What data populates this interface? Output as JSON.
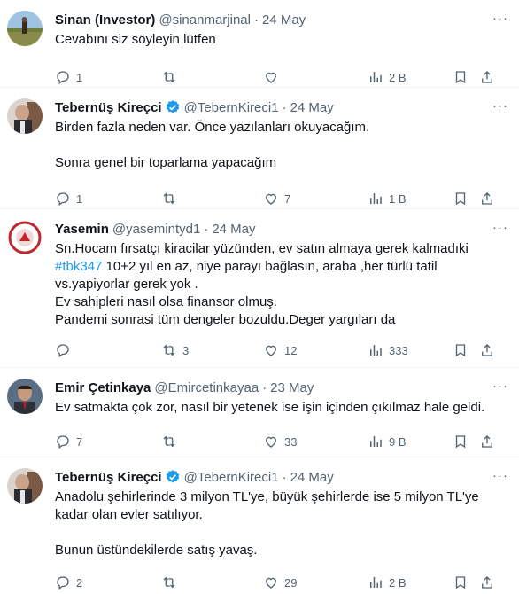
{
  "tweets": [
    {
      "name": "Sinan (Investor)",
      "verified": false,
      "handle": "@sinanmarjinal",
      "dot": "·",
      "date": "24 May",
      "text": "Cevabını siz söyleyin lütfen",
      "replies": "1",
      "retweets": "",
      "likes": "",
      "views": "2 B"
    },
    {
      "name": "Tebernüş Kireçci",
      "verified": true,
      "handle": "@TebernKireci1",
      "dot": "·",
      "date": "24 May",
      "text": "Birden fazla neden var. Önce yazılanları okuyacağım.\n\nSonra genel bir toparlama yapacağım",
      "replies": "1",
      "retweets": "",
      "likes": "7",
      "views": "1 B"
    },
    {
      "name": "Yasemin",
      "verified": false,
      "handle": "@yasemintyd1",
      "dot": "·",
      "date": "24 May",
      "text_before": "Sn.Hocam fırsatçı kiracilar yüzünden, ev satın almaya gerek kalmadıki\n",
      "hashtag": "#tbk347",
      "text_after": " 10+2 yıl en az, niye parayı bağlasın, araba ,her türlü tatil\nvs.yapiyorlar gerek  yok .\nEv sahipleri nasıl olsa finansor olmuş.\nPandemi sonrasi tüm dengeler bozuldu.Deger yargıları da",
      "replies": "",
      "retweets": "3",
      "likes": "12",
      "views": "333"
    },
    {
      "name": "Emir Çetinkaya",
      "verified": false,
      "handle": "@Emircetinkayaa",
      "dot": "·",
      "date": "23 May",
      "text": "Ev satmakta çok zor, nasıl bir yetenek ise işin içinden çıkılmaz hale geldi.",
      "replies": "7",
      "retweets": "",
      "likes": "33",
      "views": "9 B"
    },
    {
      "name": "Tebernüş Kireçci",
      "verified": true,
      "handle": "@TebernKireci1",
      "dot": "·",
      "date": "24 May",
      "text": "Anadolu şehirlerinde 3 milyon TL'ye, büyük şehirlerde ise 5 milyon TL'ye\nkadar olan evler satılıyor.\n\nBunun üstündekilerde satış yavaş.",
      "replies": "2",
      "retweets": "",
      "likes": "29",
      "views": "2 B"
    }
  ],
  "more_label": "···",
  "colors": {
    "text": "#0f1419",
    "secondary": "#536471",
    "accent": "#1d9bf0",
    "divider": "#eff3f4"
  },
  "icons": [
    "reply-icon",
    "retweet-icon",
    "like-icon",
    "views-icon",
    "bookmark-icon",
    "share-icon",
    "verified-badge-icon",
    "more-icon"
  ]
}
